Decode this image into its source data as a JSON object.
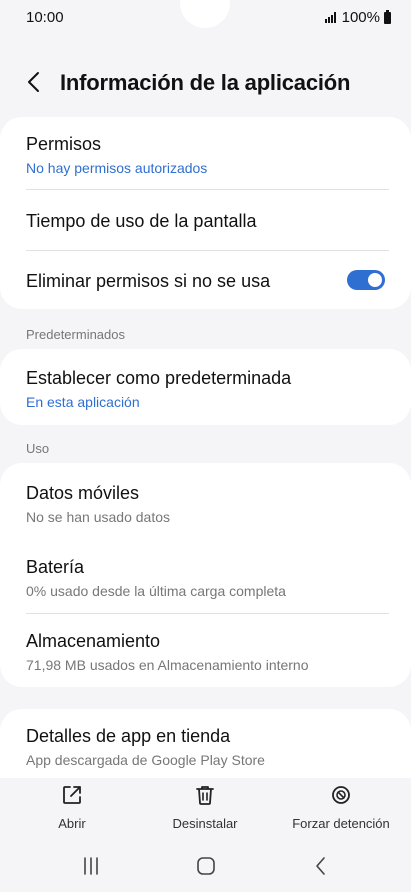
{
  "status_bar": {
    "time": "10:00",
    "battery_text": "100%",
    "icons": [
      "signal-icon",
      "battery-icon"
    ]
  },
  "header": {
    "title": "Información de la aplicación",
    "back_icon": "chevron-left-icon"
  },
  "card1": {
    "permisos_title": "Permisos",
    "permisos_subtitle": "No hay permisos autorizados",
    "tiempo_title": "Tiempo de uso de la pantalla",
    "eliminar_title": "Eliminar permisos si no se usa",
    "eliminar_toggle_on": true
  },
  "section_predeterminados": "Predeterminados",
  "card2": {
    "establecer_title": "Establecer como predeterminada",
    "establecer_subtitle": "En esta aplicación"
  },
  "section_uso": "Uso",
  "card3": {
    "datos_title": "Datos móviles",
    "datos_subtitle": "No se han usado datos",
    "bateria_title": "Batería",
    "bateria_subtitle": "0% usado desde la última carga completa",
    "almacenamiento_title": "Almacenamiento",
    "almacenamiento_subtitle": "71,98 MB usados en Almacenamiento interno"
  },
  "card4": {
    "detalles_title": "Detalles de app en tienda",
    "detalles_subtitle": "App descargada de Google Play Store"
  },
  "bottom_actions": {
    "abrir": "Abrir",
    "desinstalar": "Desinstalar",
    "forzar": "Forzar detención"
  },
  "colors": {
    "accent": "#2f6fd1",
    "background": "#f5f5f7",
    "card": "#ffffff"
  }
}
